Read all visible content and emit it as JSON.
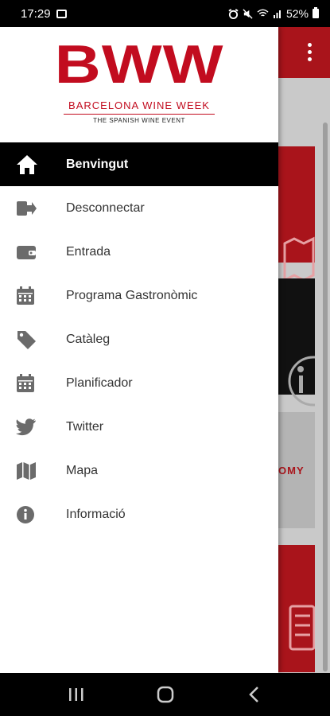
{
  "status": {
    "time": "17:29",
    "battery": "52%",
    "icons": [
      "gallery-icon",
      "alarm-icon",
      "mute-icon",
      "wifi-icon",
      "signal-icon",
      "battery-icon"
    ]
  },
  "brand": {
    "logo": "BWW",
    "tagline": "BARCELONA WINE WEEK",
    "subtitle": "THE SPANISH WINE EVENT",
    "color": "#c20c1f"
  },
  "menu": {
    "items": [
      {
        "label": "Benvingut",
        "icon": "home-icon",
        "active": true
      },
      {
        "label": "Desconnectar",
        "icon": "logout-icon",
        "active": false
      },
      {
        "label": "Entrada",
        "icon": "wallet-icon",
        "active": false
      },
      {
        "label": "Programa Gastronòmic",
        "icon": "calendar-icon",
        "active": false
      },
      {
        "label": "Catàleg",
        "icon": "tag-icon",
        "active": false
      },
      {
        "label": "Planificador",
        "icon": "calendar-icon",
        "active": false
      },
      {
        "label": "Twitter",
        "icon": "twitter-icon",
        "active": false
      },
      {
        "label": "Mapa",
        "icon": "map-icon",
        "active": false
      },
      {
        "label": "Informació",
        "icon": "info-icon",
        "active": false
      }
    ]
  },
  "background": {
    "partial_text": "OMY",
    "accent": "#a9141b"
  }
}
